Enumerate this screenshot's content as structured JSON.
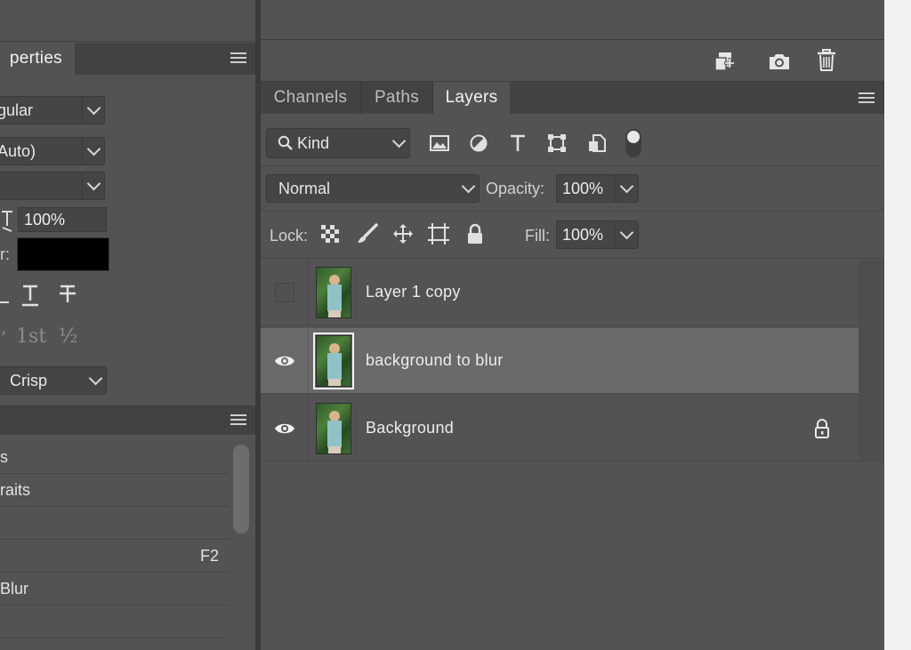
{
  "left_panel": {
    "properties_tab": "perties",
    "dropdowns": [
      "gular",
      "Auto)",
      ""
    ],
    "scale_value": "100%",
    "color_label": "r:",
    "color_swatch": "#000000",
    "typo_icons": [
      "faux-italic-icon",
      "underline-icon",
      "strikethrough-icon"
    ],
    "opentype_glyphs": [
      "1st",
      "½"
    ],
    "antialias_value": "Crisp",
    "actions_list": [
      {
        "label": "s",
        "shortcut": ""
      },
      {
        "label": "raits",
        "shortcut": ""
      },
      {
        "label": "",
        "shortcut": ""
      },
      {
        "label": "",
        "shortcut": "F2"
      },
      {
        "label": "Blur",
        "shortcut": ""
      },
      {
        "label": "",
        "shortcut": ""
      }
    ]
  },
  "top_toolbar": {
    "icons": [
      "new-from-selection-icon",
      "camera-icon",
      "trash-icon"
    ]
  },
  "layers_panel": {
    "tabs": [
      {
        "label": "Channels",
        "active": false
      },
      {
        "label": "Paths",
        "active": false
      },
      {
        "label": "Layers",
        "active": true
      }
    ],
    "filter_kind": "Kind",
    "filter_icons": [
      "image-filter-icon",
      "adjustment-filter-icon",
      "type-filter-icon",
      "shape-filter-icon",
      "smart-object-filter-icon",
      "filter-toggle-icon"
    ],
    "blend_mode": "Normal",
    "opacity_label": "Opacity:",
    "opacity_value": "100%",
    "lock_label": "Lock:",
    "lock_icons": [
      "lock-transparent-pixels-icon",
      "lock-image-pixels-icon",
      "lock-position-icon",
      "lock-artboard-icon",
      "lock-all-icon"
    ],
    "fill_label": "Fill:",
    "fill_value": "100%",
    "layers": [
      {
        "name": "Layer 1 copy",
        "visible": false,
        "selected": false,
        "locked": false
      },
      {
        "name": "background to blur",
        "visible": true,
        "selected": true,
        "locked": false
      },
      {
        "name": "Background",
        "visible": true,
        "selected": false,
        "locked": true
      }
    ]
  }
}
